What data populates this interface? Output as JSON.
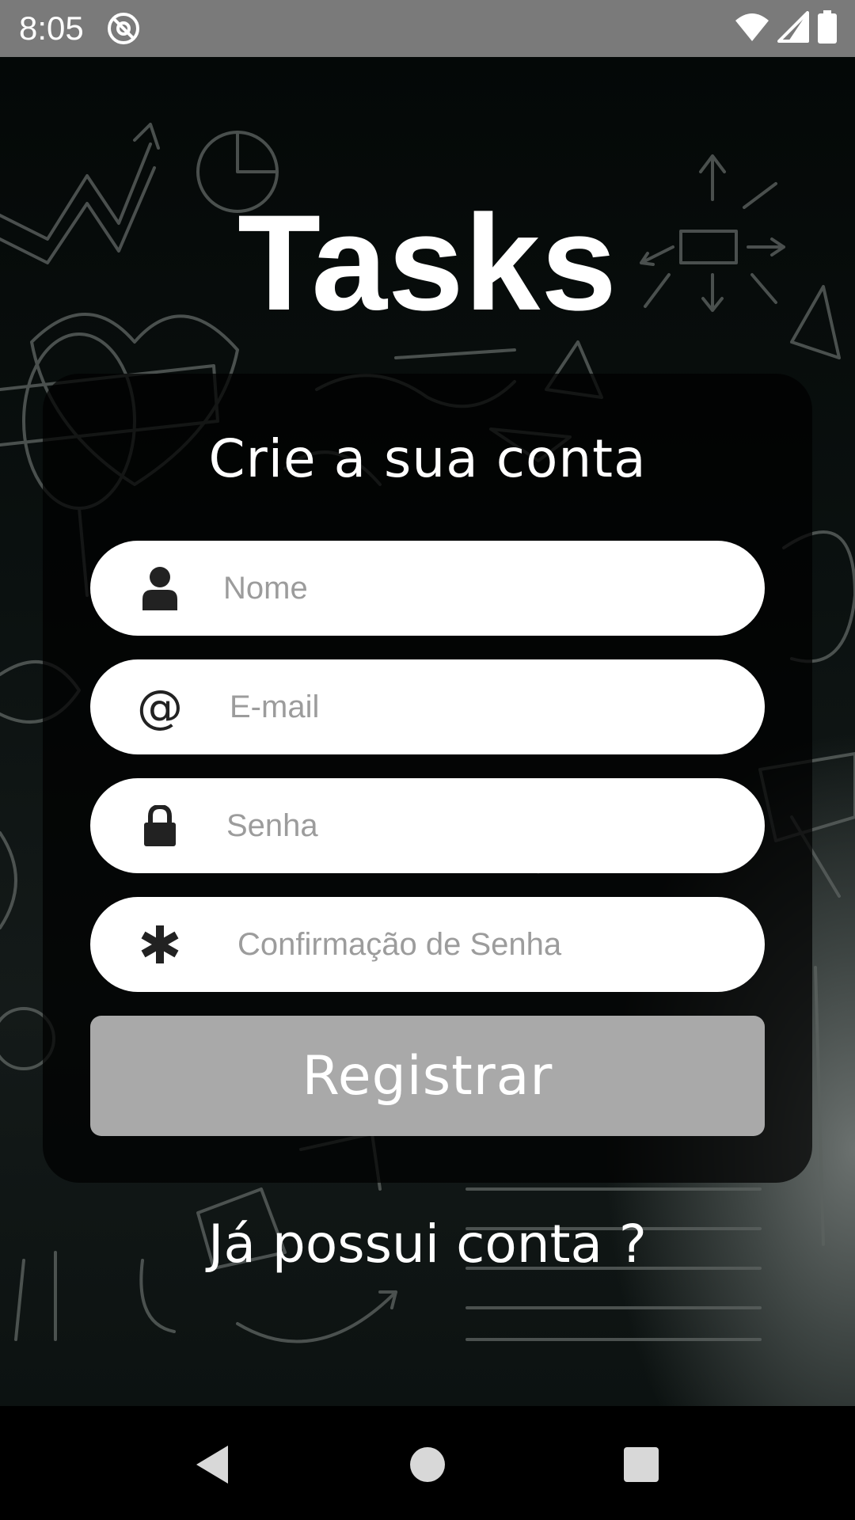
{
  "status_bar": {
    "time": "8:05",
    "left_icon": "sync-at-icon",
    "right_icons": [
      "wifi-icon",
      "cell-signal-icon",
      "battery-icon"
    ]
  },
  "app": {
    "title": "Tasks"
  },
  "form": {
    "title": "Crie a sua conta",
    "fields": [
      {
        "icon": "person-icon",
        "placeholder": "Nome",
        "value": ""
      },
      {
        "icon": "at-icon",
        "placeholder": "E-mail",
        "value": ""
      },
      {
        "icon": "lock-icon",
        "placeholder": "Senha",
        "value": ""
      },
      {
        "icon": "asterisk-icon",
        "placeholder": "Confirmação de Senha",
        "value": ""
      }
    ],
    "submit_label": "Registrar",
    "login_link": "Já possui conta ?"
  },
  "nav_bar": {
    "buttons": [
      "back-icon",
      "home-icon",
      "recents-icon"
    ]
  },
  "colors": {
    "status_bar": "#7a7a7a",
    "button_disabled": "#a9a9a9",
    "input_background": "#ffffff",
    "placeholder": "#9c9c9c"
  }
}
